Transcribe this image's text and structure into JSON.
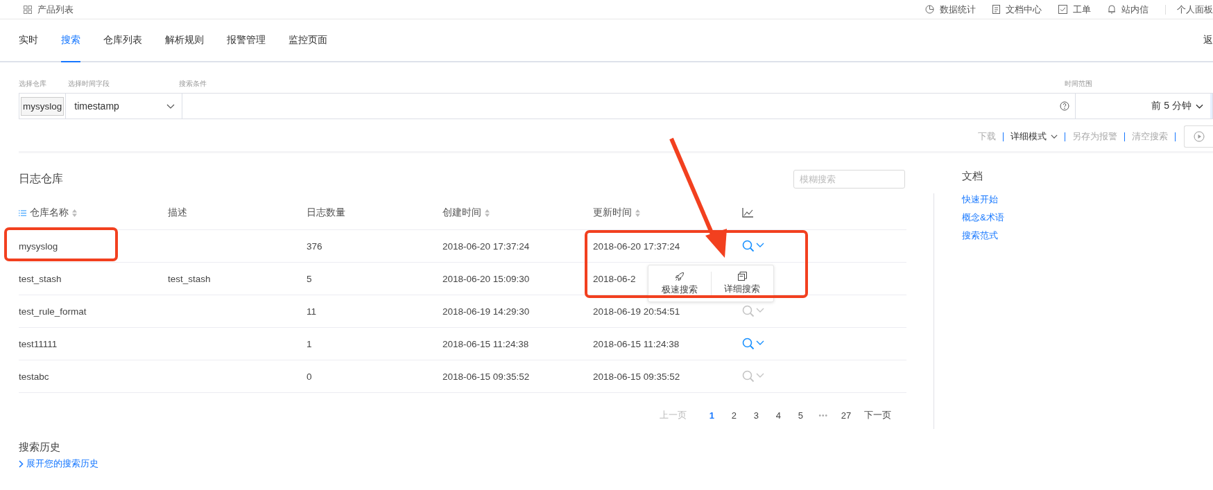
{
  "top_bar": {
    "title": "产品列表",
    "links": [
      {
        "kind": "chart",
        "label": "数据统计"
      },
      {
        "kind": "doc",
        "label": "文档中心"
      },
      {
        "kind": "check",
        "label": "工单"
      },
      {
        "kind": "bell",
        "label": "站内信"
      },
      {
        "kind": "none",
        "label": "个人面板"
      }
    ]
  },
  "tabs": [
    {
      "label": "实时",
      "selected": false
    },
    {
      "label": "搜索",
      "selected": true
    },
    {
      "label": "仓库列表",
      "selected": false
    },
    {
      "label": "解析规则",
      "selected": false
    },
    {
      "label": "报警管理",
      "selected": false
    },
    {
      "label": "监控页面",
      "selected": false
    }
  ],
  "back": "返",
  "filters": {
    "repo_label": "选择仓库",
    "field_label": "选择时间字段",
    "query_label": "搜索条件",
    "range_label": "时间范围",
    "repo": "mysyslog",
    "time_field": "timestamp",
    "range": "前 5 分钟"
  },
  "toolbar": {
    "download": "下载",
    "mode": "详细模式",
    "save_alert": "另存为报警",
    "clear": "清空搜索"
  },
  "repo_section": {
    "title": "日志仓库",
    "search_placeholder": "模糊搜索",
    "columns": [
      {
        "kind": "list",
        "label": "仓库名称",
        "sortable": true
      },
      {
        "kind": "text",
        "label": "描述"
      },
      {
        "kind": "text",
        "label": "日志数量"
      },
      {
        "kind": "text",
        "label": "创建时间",
        "sortable": true
      },
      {
        "kind": "text",
        "label": "更新时间",
        "sortable": true
      },
      {
        "kind": "chart"
      }
    ],
    "rows": [
      {
        "name": "mysyslog",
        "description": "",
        "count": "376",
        "created": "2018-06-20 17:37:24",
        "updated": "2018-06-20 17:37:24",
        "action_enabled": true
      },
      {
        "name": "test_stash",
        "description": "test_stash",
        "count": "5",
        "created": "2018-06-20 15:09:30",
        "updated": "2018-06-2"
      },
      {
        "name": "test_rule_format",
        "description": "",
        "count": "11",
        "created": "2018-06-19 14:29:30",
        "updated": "2018-06-19 20:54:51",
        "action_enabled": false
      },
      {
        "name": "test11111",
        "description": "",
        "count": "1",
        "created": "2018-06-15 11:24:38",
        "updated": "2018-06-15 11:24:38",
        "action_enabled": true
      },
      {
        "name": "testabc",
        "description": "",
        "count": "0",
        "created": "2018-06-15 09:35:52",
        "updated": "2018-06-15 09:35:52",
        "action_enabled": false
      }
    ]
  },
  "popup": {
    "items": [
      {
        "kind": "rocket",
        "label": "极速搜索"
      },
      {
        "kind": "copy",
        "label": "详细搜索"
      }
    ]
  },
  "pagination": {
    "prev": {
      "label": "上一页",
      "disabled": true
    },
    "pages": [
      {
        "kind": "page",
        "label": "1",
        "selected": true
      },
      {
        "kind": "page",
        "label": "2",
        "selected": false
      },
      {
        "kind": "page",
        "label": "3",
        "selected": false
      },
      {
        "kind": "page",
        "label": "4",
        "selected": false
      },
      {
        "kind": "page",
        "label": "5",
        "selected": false
      },
      {
        "kind": "ellipsis",
        "label": "•••"
      },
      {
        "kind": "page",
        "label": "27",
        "selected": false
      }
    ],
    "next": {
      "label": "下一页",
      "disabled": false
    }
  },
  "history": {
    "title": "搜索历史",
    "link": "展开您的搜索历史"
  },
  "docs": {
    "title": "文档",
    "links": [
      "快速开始",
      "概念&术语",
      "搜索范式"
    ]
  }
}
